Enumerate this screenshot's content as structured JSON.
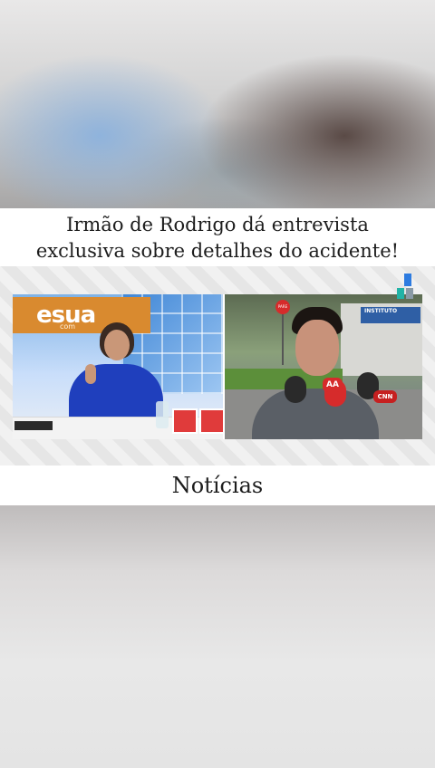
{
  "headline": {
    "line1": "Irmão de Rodrigo dá entrevista",
    "line2": "exclusiva sobre detalhes do acidente!"
  },
  "video": {
    "program_logo": "esua",
    "program_logo_sub": "com",
    "stop_sign_text": "PARE",
    "building_sign_text": "INSTITUTO",
    "mic_labels": [
      "AA",
      "CNN"
    ],
    "colors": {
      "logo_orange": "#d98a2f",
      "presenter_blue": "#1f3fbd",
      "mic_red": "#d62b2b"
    }
  },
  "caption": {
    "label": "Notícias"
  }
}
